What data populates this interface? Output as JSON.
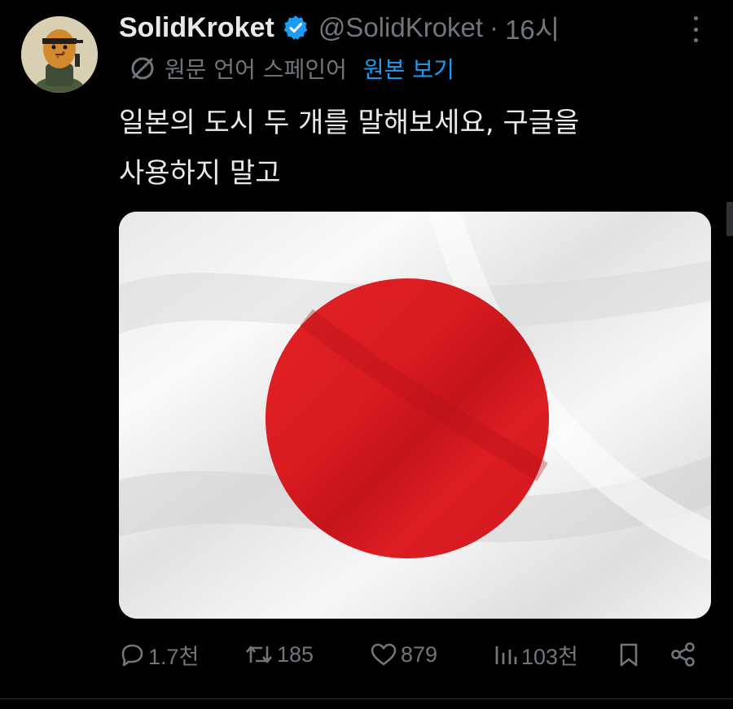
{
  "tweet": {
    "display_name": "SolidKroket",
    "handle": "@SolidKroket",
    "separator": "·",
    "time": "16시",
    "translation": {
      "note": "원문 언어 스페인어",
      "link": "원본 보기"
    },
    "text_lines": [
      "일본의 도시 두 개를 말해보세요, 구글을",
      "사용하지 말고"
    ],
    "media_subject": "japan-flag",
    "colors": {
      "background": "#000000",
      "text": "#e7e9ea",
      "muted": "#71767b",
      "link": "#1d9bf0",
      "verified": "#1d9bf0",
      "flag_red": "#d91a1e",
      "flag_white": "#f2f2f2"
    }
  },
  "actions": {
    "reply": {
      "icon": "reply-icon",
      "count": "1.7천"
    },
    "repost": {
      "icon": "repost-icon",
      "count": "185"
    },
    "like": {
      "icon": "heart-icon",
      "count": "879"
    },
    "views": {
      "icon": "views-icon",
      "count": "103천"
    },
    "bookmark": {
      "icon": "bookmark-icon"
    },
    "share": {
      "icon": "share-icon"
    }
  }
}
